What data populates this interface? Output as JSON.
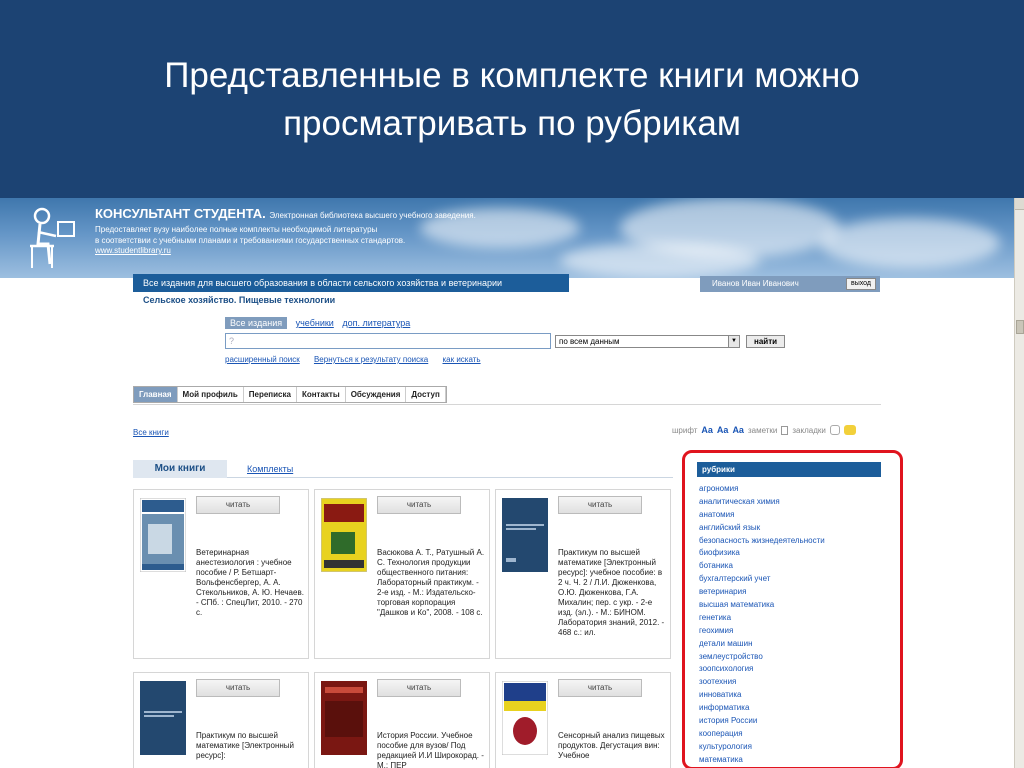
{
  "slide": {
    "title_line1": "Представленные в комплекте книги можно",
    "title_line2": "просматривать по рубрикам"
  },
  "site": {
    "brand": "КОНСУЛЬТАНТ СТУДЕНТА.",
    "brand_sub": "Электронная библиотека высшего учебного заведения.",
    "desc1": "Предоставляет вузу наиболее полные комплекты необходимой литературы",
    "desc2": "в соответствии с учебными планами и требованиями государственных стандартов.",
    "url": "www.studentlibrary.ru"
  },
  "header": {
    "section": "Все издания для высшего образования в области сельского хозяйства и ветеринарии",
    "subsection": "Сельское хозяйство. Пищевые технологии",
    "user_name": "Иванов Иван Иванович",
    "logout": "выход"
  },
  "search": {
    "tab_all": "Все издания",
    "tab_textbooks": "учебники",
    "tab_extra": "доп. литература",
    "placeholder": "?",
    "scope": "по всем данным",
    "find": "найти",
    "advanced": "расширенный поиск",
    "back": "Вернуться к результату поиска",
    "howto": "как искать"
  },
  "nav": {
    "tabs": [
      "Главная",
      "Мой профиль",
      "Переписка",
      "Контакты",
      "Обсуждения",
      "Доступ"
    ]
  },
  "toolbar": {
    "all_books": "Все книги",
    "font": "шрифт",
    "aa": "Aa",
    "notes": "заметки",
    "bookmarks": "закладки"
  },
  "books_tabs": {
    "my_books": "Мои книги",
    "sets": "Комплекты"
  },
  "books": [
    {
      "read": "читать",
      "line1": "Ветеринарная анестезиология : учебное пособие / Р. Бетшарт-Вольфенсбергер, А. А. Стекольников, А. Ю. Нечаев. - СПб. : СпецЛит, 2010. - 270 с.",
      "cover_title": "Ветеринарная анестезиология"
    },
    {
      "read": "читать",
      "line1": "Васюкова А. Т., Ратушный А. С. Технология продукции общественного питания: Лабораторный практикум. - 2-е изд. - М.: Издательско-торговая корпорация \"Дашков и Ко\", 2008. - 108 с.",
      "cover_title": "Технология продукции общественного питания"
    },
    {
      "read": "читать",
      "line1": "Практикум по высшей математике [Электронный ресурс]: учебное пособие: в 2 ч. Ч. 2 / Л.И. Дюженкова, О.Ю. Дюженкова, Г.А. Михалин; пер. с укр. - 2-е изд. (эл.). - М.: БИНОМ. Лаборатория знаний, 2012. - 468 с.: ил.",
      "cover_title": "Практикум по высшей математике"
    },
    {
      "read": "читать",
      "line1": "Практикум по высшей математике [Электронный ресурс]:",
      "cover_title": "Практикум по высшей математике"
    },
    {
      "read": "читать",
      "line1": "История России. Учебное пособие для вузов/ Под редакцией И.И Широкорад. - М.: ПЕР",
      "cover_title": "История России"
    },
    {
      "read": "читать",
      "line1": "Сенсорный анализ пищевых продуктов. Дегустация вин: Учебное",
      "cover_title": "Сенсорный анализ пищевых продуктов"
    }
  ],
  "rubrics": {
    "title": "рубрики",
    "items": [
      "агрономия",
      "аналитическая химия",
      "анатомия",
      "английский язык",
      "безопасность жизнедеятельности",
      "биофизика",
      "ботаника",
      "бухгалтерский учет",
      "ветеринария",
      "высшая математика",
      "генетика",
      "геохимия",
      "детали машин",
      "землеустройство",
      "зоопсихология",
      "зоотехния",
      "инноватика",
      "информатика",
      "история России",
      "кооперация",
      "культурология",
      "математика"
    ]
  },
  "colors": {
    "slide_bg": "#1c4373",
    "site_blue": "#1c5d9a",
    "highlight": "#e0141e"
  }
}
